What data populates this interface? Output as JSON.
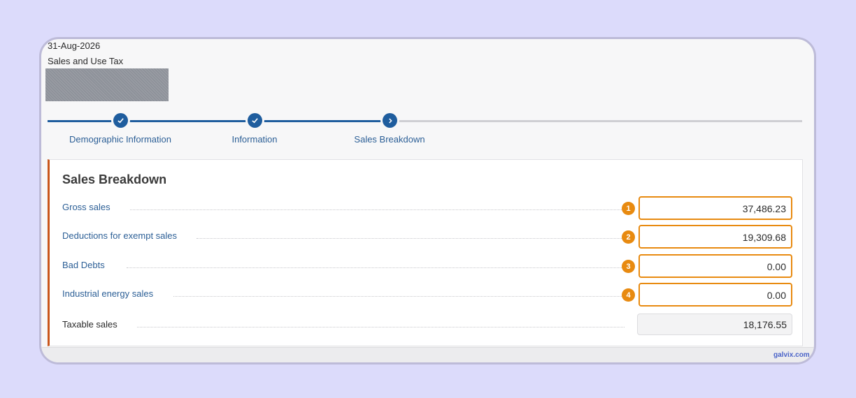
{
  "header": {
    "date": "31-Aug-2026",
    "doc_type": "Sales and Use Tax"
  },
  "stepper": {
    "steps": [
      {
        "label": "Demographic Information",
        "state": "complete",
        "icon": "check-icon"
      },
      {
        "label": "Information",
        "state": "complete",
        "icon": "check-icon"
      },
      {
        "label": "Sales Breakdown",
        "state": "current",
        "icon": "chevron-right-icon"
      }
    ],
    "colors": {
      "active": "#1f5d9e",
      "inactive": "#cfcfd3"
    }
  },
  "card": {
    "title": "Sales Breakdown",
    "accent_color": "#c9561c",
    "rows": [
      {
        "label": "Gross sales",
        "badge": "1",
        "value": "37,486.23"
      },
      {
        "label": "Deductions for exempt sales",
        "badge": "2",
        "value": "19,309.68"
      },
      {
        "label": "Bad Debts",
        "badge": "3",
        "value": "0.00"
      },
      {
        "label": "Industrial energy sales",
        "badge": "4",
        "value": "0.00"
      }
    ],
    "total": {
      "label": "Taxable sales",
      "value": "18,176.55"
    }
  },
  "highlight_color": "#e88a10",
  "watermark": "galvix.com"
}
